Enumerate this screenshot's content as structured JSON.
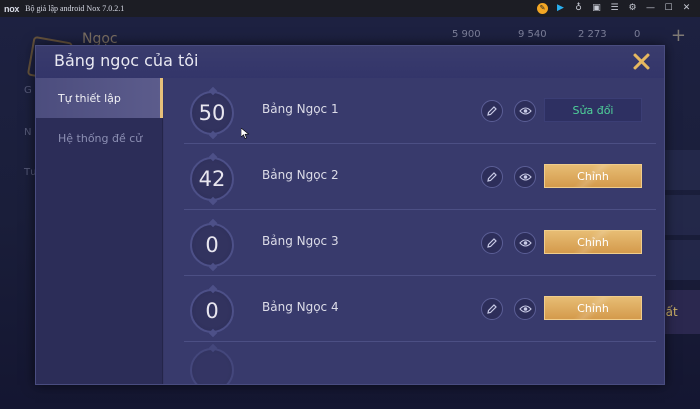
{
  "emulator": {
    "logo": "nox",
    "title": "Bộ giả lập android Nox 7.0.2.1",
    "icons": [
      "orange-circle-icon",
      "play-icon",
      "mic-icon",
      "screenshot-icon",
      "list-icon",
      "gear-icon",
      "minimize-icon",
      "maximize-icon",
      "close-icon"
    ]
  },
  "background": {
    "player_name": "Ngọc",
    "resources": [
      {
        "icon": "gem-icon",
        "value": "5 900"
      },
      {
        "icon": "gold-icon",
        "value": "9 540"
      },
      {
        "icon": "ruby-icon",
        "value": "2 273"
      },
      {
        "icon": "card-icon",
        "value": "0"
      }
    ],
    "side_labels": [
      "G",
      "N",
      "Tư"
    ],
    "right_button_label": "hất"
  },
  "dialog": {
    "title": "Bảng ngọc của tôi",
    "tabs": [
      {
        "label": "Tự thiết lập",
        "active": true
      },
      {
        "label": "Hệ thống đề cử",
        "active": false
      }
    ],
    "rows": [
      {
        "level": "50",
        "name": "Bảng Ngọc 1",
        "action": "Sửa đổi",
        "style": "modify"
      },
      {
        "level": "42",
        "name": "Bảng Ngọc 2",
        "action": "Chỉnh",
        "style": "edit"
      },
      {
        "level": "0",
        "name": "Bảng Ngọc 3",
        "action": "Chỉnh",
        "style": "edit"
      },
      {
        "level": "0",
        "name": "Bảng Ngọc 4",
        "action": "Chỉnh",
        "style": "edit"
      }
    ]
  },
  "colors": {
    "accent_gold": "#e6b860",
    "modify_text": "#4fd29a",
    "dialog_bg": "#383a6c"
  }
}
